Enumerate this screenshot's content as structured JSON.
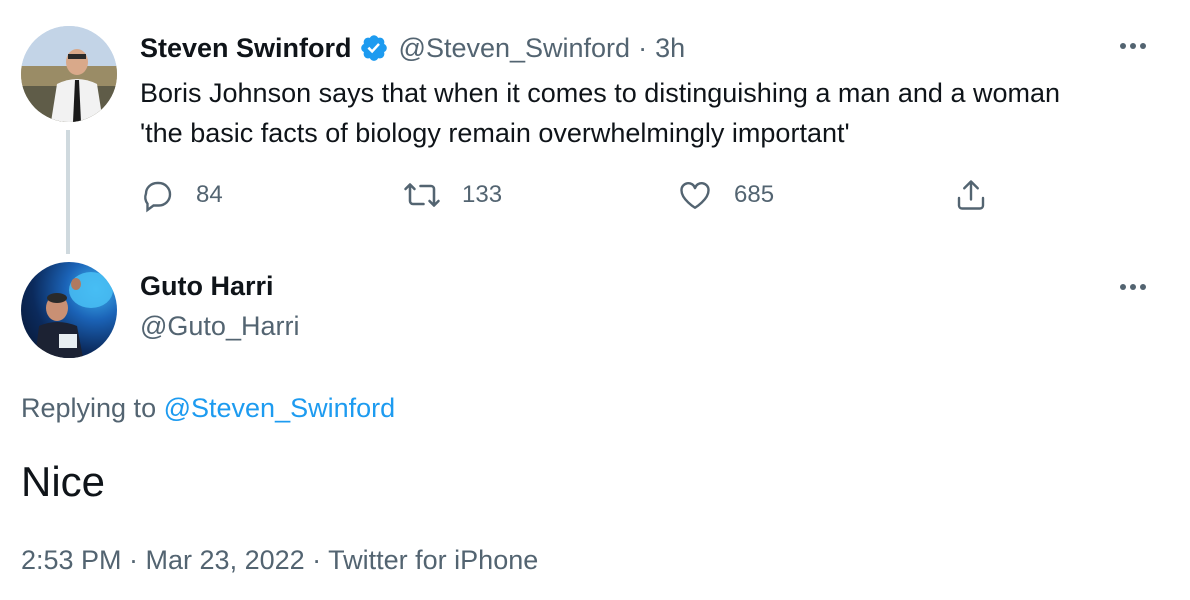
{
  "colors": {
    "accent": "#1d9bf0",
    "text": "#0f1419",
    "muted": "#536471",
    "thread_line": "#cfd9de"
  },
  "parent_tweet": {
    "display_name": "Steven Swinford",
    "verified_icon": "verified-badge-icon",
    "handle": "@Steven_Swinford",
    "separator": "·",
    "time": "3h",
    "text": "Boris Johnson says that when it comes to distinguishing a man and a woman 'the basic facts of biology remain overwhelmingly important'",
    "actions": {
      "reply_count": "84",
      "retweet_count": "133",
      "like_count": "685"
    },
    "more_icon": "more-icon"
  },
  "reply_tweet": {
    "display_name": "Guto Harri",
    "handle": "@Guto_Harri",
    "replying_label": "Replying to",
    "replying_handle": "@Steven_Swinford",
    "text": "Nice",
    "timestamp": "2:53 PM · Mar 23, 2022 · Twitter for iPhone",
    "more_icon": "more-icon"
  }
}
